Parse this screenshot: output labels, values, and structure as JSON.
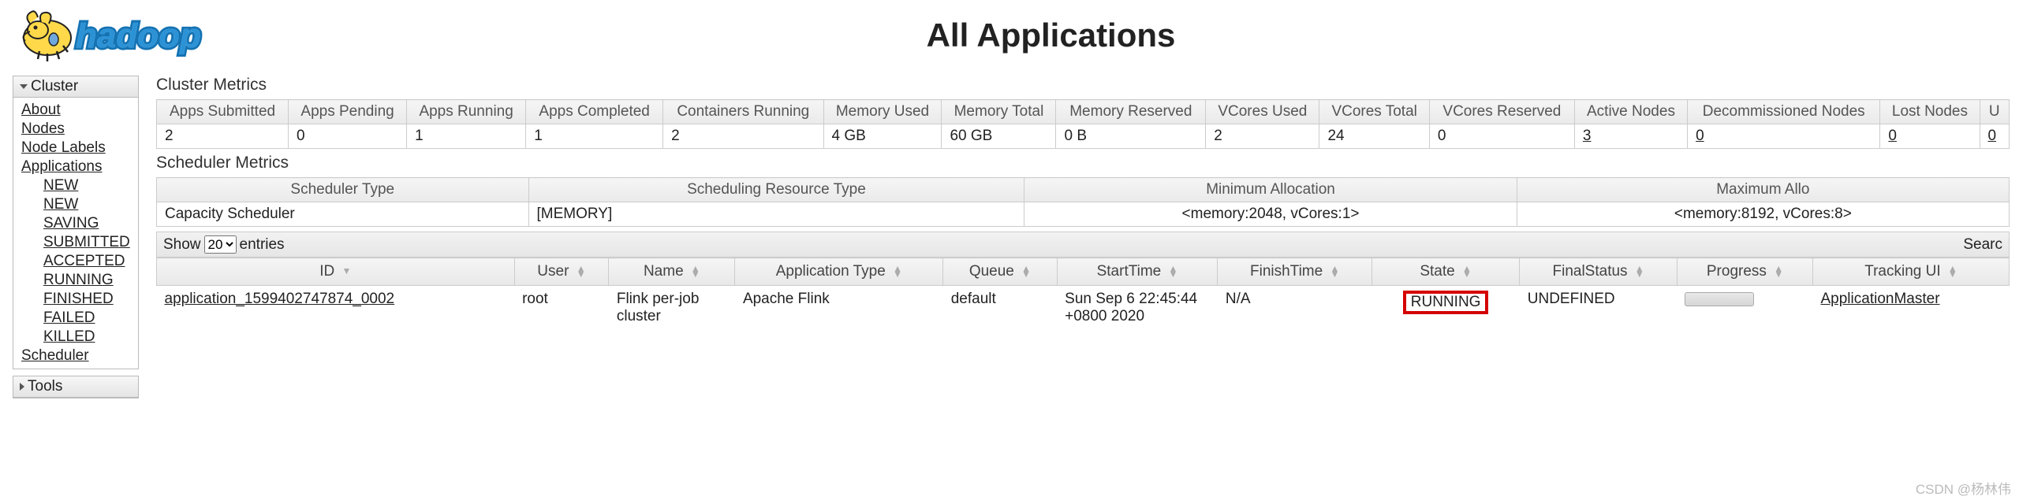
{
  "page_title": "All Applications",
  "sidebar": {
    "cluster_label": "Cluster",
    "tools_label": "Tools",
    "links": {
      "about": "About",
      "nodes": "Nodes",
      "node_labels": "Node Labels",
      "applications": "Applications",
      "scheduler": "Scheduler"
    },
    "app_states": [
      "NEW",
      "NEW SAVING",
      "SUBMITTED",
      "ACCEPTED",
      "RUNNING",
      "FINISHED",
      "FAILED",
      "KILLED"
    ]
  },
  "sections": {
    "cluster_metrics": "Cluster Metrics",
    "scheduler_metrics": "Scheduler Metrics"
  },
  "cluster_metrics": {
    "headers": [
      "Apps Submitted",
      "Apps Pending",
      "Apps Running",
      "Apps Completed",
      "Containers Running",
      "Memory Used",
      "Memory Total",
      "Memory Reserved",
      "VCores Used",
      "VCores Total",
      "VCores Reserved",
      "Active Nodes",
      "Decommissioned Nodes",
      "Lost Nodes",
      "U"
    ],
    "values": [
      "2",
      "0",
      "1",
      "1",
      "2",
      "4 GB",
      "60 GB",
      "0 B",
      "2",
      "24",
      "0",
      "3",
      "0",
      "0",
      "0"
    ]
  },
  "scheduler_metrics": {
    "headers": [
      "Scheduler Type",
      "Scheduling Resource Type",
      "Minimum Allocation",
      "Maximum Allo"
    ],
    "values": [
      "Capacity Scheduler",
      "[MEMORY]",
      "<memory:2048, vCores:1>",
      "<memory:8192, vCores:8>"
    ]
  },
  "datatable": {
    "show_label": "Show",
    "entries_label": "entries",
    "page_size": "20",
    "search_label": "Searc",
    "headers": [
      "ID",
      "User",
      "Name",
      "Application Type",
      "Queue",
      "StartTime",
      "FinishTime",
      "State",
      "FinalStatus",
      "Progress",
      "Tracking UI"
    ],
    "row": {
      "id": "application_1599402747874_0002",
      "user": "root",
      "name": "Flink per-job cluster",
      "app_type": "Apache Flink",
      "queue": "default",
      "start_time": "Sun Sep 6 22:45:44 +0800 2020",
      "finish_time": "N/A",
      "state": "RUNNING",
      "final_status": "UNDEFINED",
      "tracking_ui": "ApplicationMaster"
    }
  },
  "watermark": "CSDN @杨林伟"
}
